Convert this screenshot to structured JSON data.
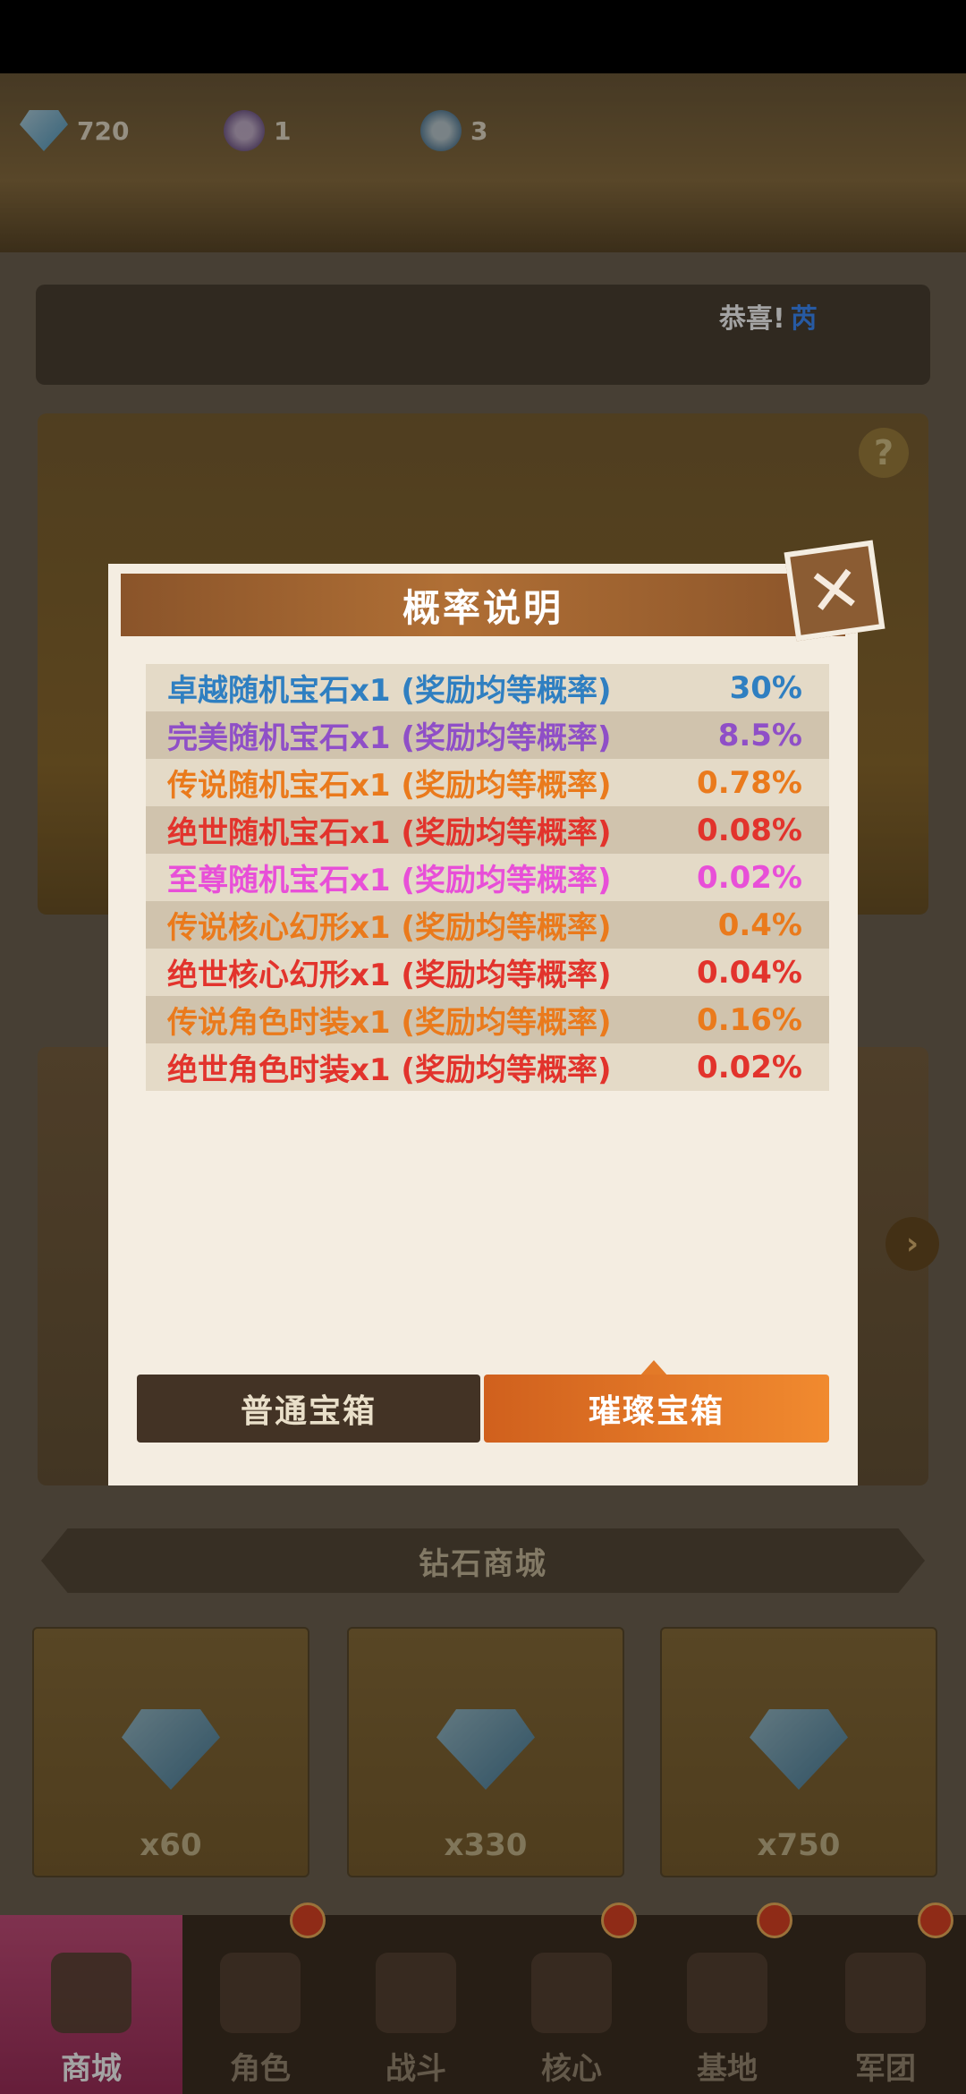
{
  "resources": [
    {
      "icon": "diamond-icon",
      "value": "720"
    },
    {
      "icon": "purple-key-icon",
      "value": "1"
    },
    {
      "icon": "blue-key-icon",
      "value": "3"
    }
  ],
  "toast": {
    "prefix": "恭喜!",
    "name": "芮"
  },
  "help_label": "?",
  "side_arrow": "›",
  "shop": {
    "title": "钻石商城",
    "items": [
      {
        "qty": "x60"
      },
      {
        "qty": "x330"
      },
      {
        "qty": "x750"
      }
    ]
  },
  "nav": [
    {
      "label": "商城",
      "icon": "shop-icon",
      "active": true
    },
    {
      "label": "角色",
      "icon": "character-icon",
      "active": false
    },
    {
      "label": "战斗",
      "icon": "battle-icon",
      "active": false
    },
    {
      "label": "核心",
      "icon": "core-icon",
      "active": false
    },
    {
      "label": "基地",
      "icon": "base-icon",
      "active": false
    },
    {
      "label": "军团",
      "icon": "legion-icon",
      "active": false
    }
  ],
  "modal": {
    "title": "概率说明",
    "close_label": "✕",
    "rows": [
      {
        "label": "卓越随机宝石x1 (奖励均等概率)",
        "value": "30%",
        "color": "#2f7fc1"
      },
      {
        "label": "完美随机宝石x1 (奖励均等概率)",
        "value": "8.5%",
        "color": "#8f4fc7"
      },
      {
        "label": "传说随机宝石x1 (奖励均等概率)",
        "value": "0.78%",
        "color": "#ea7a1c"
      },
      {
        "label": "绝世随机宝石x1 (奖励均等概率)",
        "value": "0.08%",
        "color": "#e2332c"
      },
      {
        "label": "至尊随机宝石x1 (奖励均等概率)",
        "value": "0.02%",
        "color": "#e84fd8"
      },
      {
        "label": "传说核心幻形x1 (奖励均等概率)",
        "value": "0.4%",
        "color": "#ea7a1c"
      },
      {
        "label": "绝世核心幻形x1 (奖励均等概率)",
        "value": "0.04%",
        "color": "#e2332c"
      },
      {
        "label": "传说角色时装x1 (奖励均等概率)",
        "value": "0.16%",
        "color": "#ea7a1c"
      },
      {
        "label": "绝世角色时装x1 (奖励均等概率)",
        "value": "0.02%",
        "color": "#e2332c"
      }
    ],
    "tabs": [
      {
        "label": "普通宝箱",
        "selected": false
      },
      {
        "label": "璀璨宝箱",
        "selected": true
      }
    ]
  }
}
